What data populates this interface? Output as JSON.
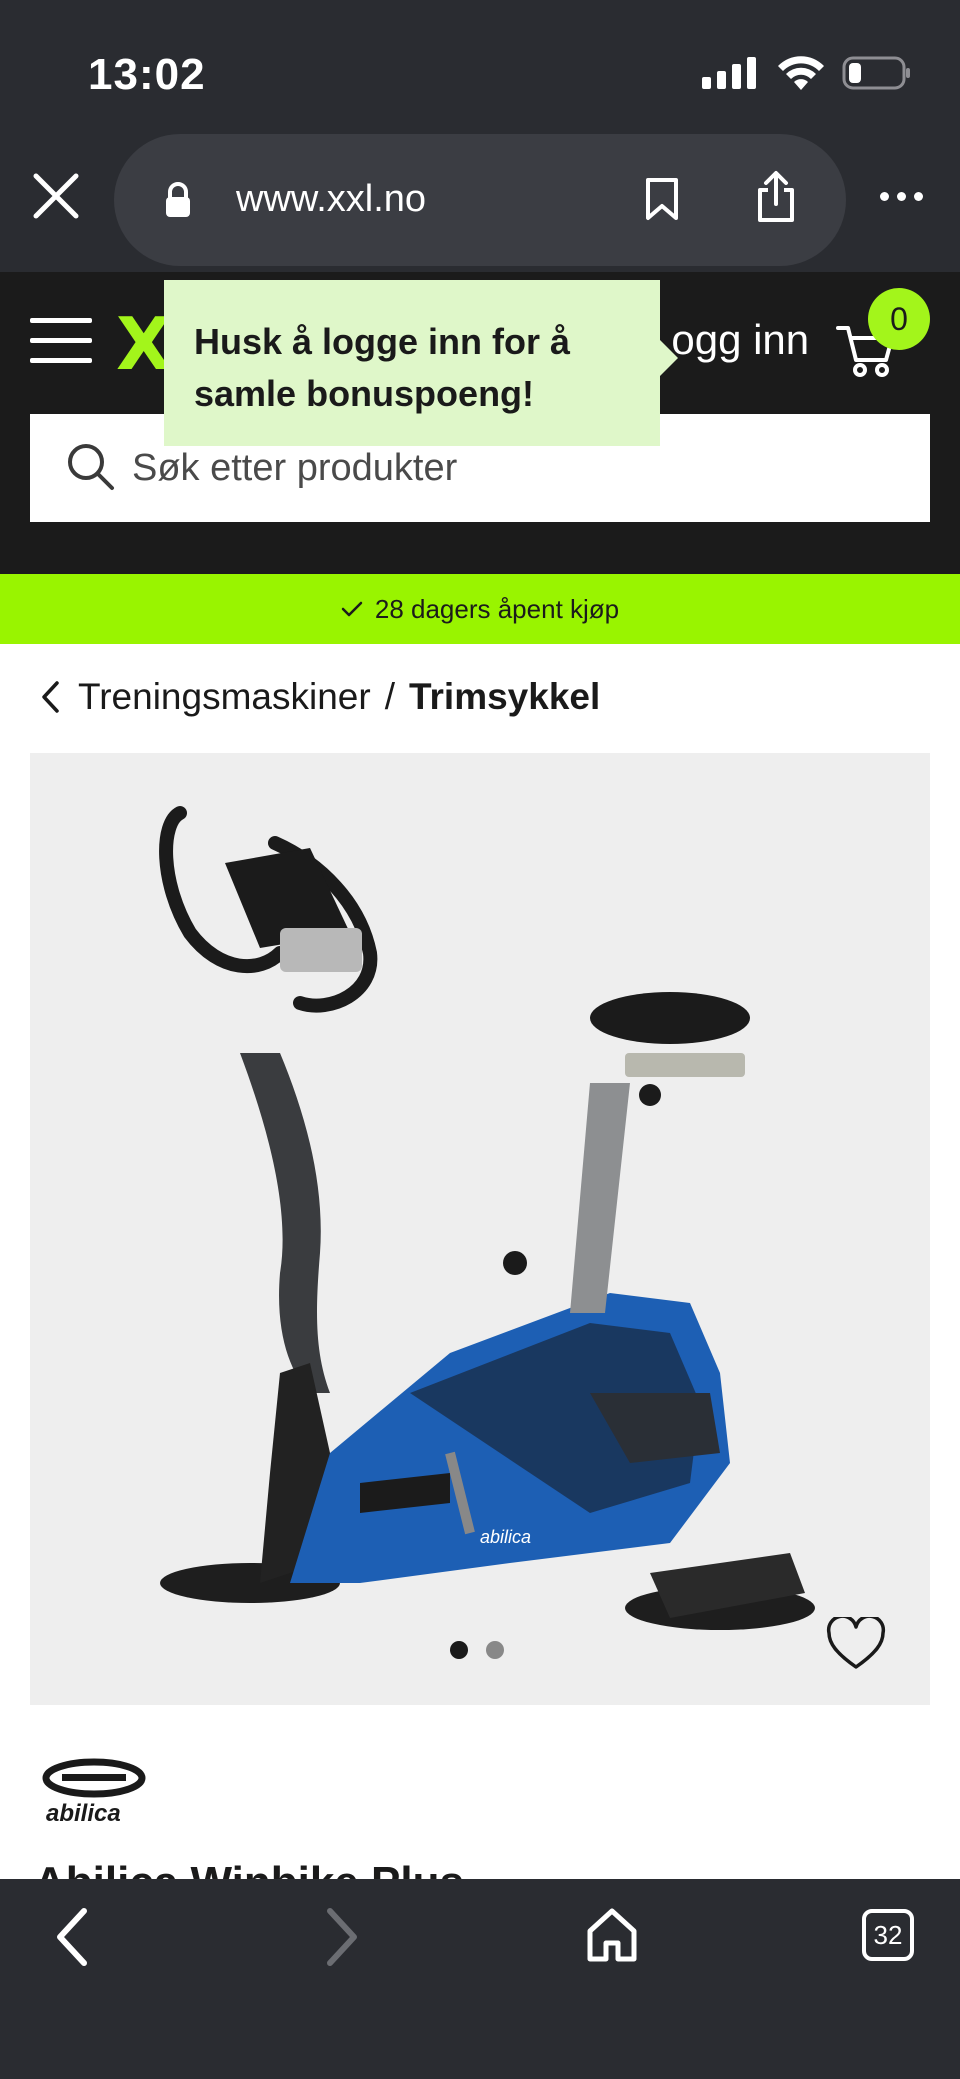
{
  "status": {
    "time": "13:02"
  },
  "browser": {
    "url": "www.xxl.no"
  },
  "header": {
    "logo": "XXL",
    "login_label": "Logg inn",
    "cart_count": "0"
  },
  "search": {
    "placeholder": "Søk etter produkter"
  },
  "tooltip": {
    "text": "Husk å logge inn for å samle bonuspoeng!"
  },
  "promo": {
    "text": "28 dagers åpent kjøp"
  },
  "breadcrumb": {
    "parent": "Treningsmaskiner",
    "separator": "/",
    "current": "Trimsykkel"
  },
  "product": {
    "brand": "abilica",
    "title": "Abilica Winbike Plus",
    "image_brand_label": "abilica",
    "image_dots_total": 2,
    "image_dots_active": 1
  },
  "toolbar": {
    "tabs_count": "32"
  },
  "colors": {
    "accent_green": "#99f400",
    "header_dark": "#1b1b1b",
    "browser_dark": "#2a2c31",
    "tooltip_bg": "#dff7c9"
  },
  "icons": [
    "signal-icon",
    "wifi-icon",
    "battery-icon",
    "close-icon",
    "lock-icon",
    "bookmark-icon",
    "share-icon",
    "more-icon",
    "menu-icon",
    "cart-icon",
    "search-icon",
    "check-icon",
    "chevron-left-icon",
    "heart-icon",
    "back-arrow-icon",
    "forward-arrow-icon",
    "home-icon",
    "tabs-icon"
  ]
}
